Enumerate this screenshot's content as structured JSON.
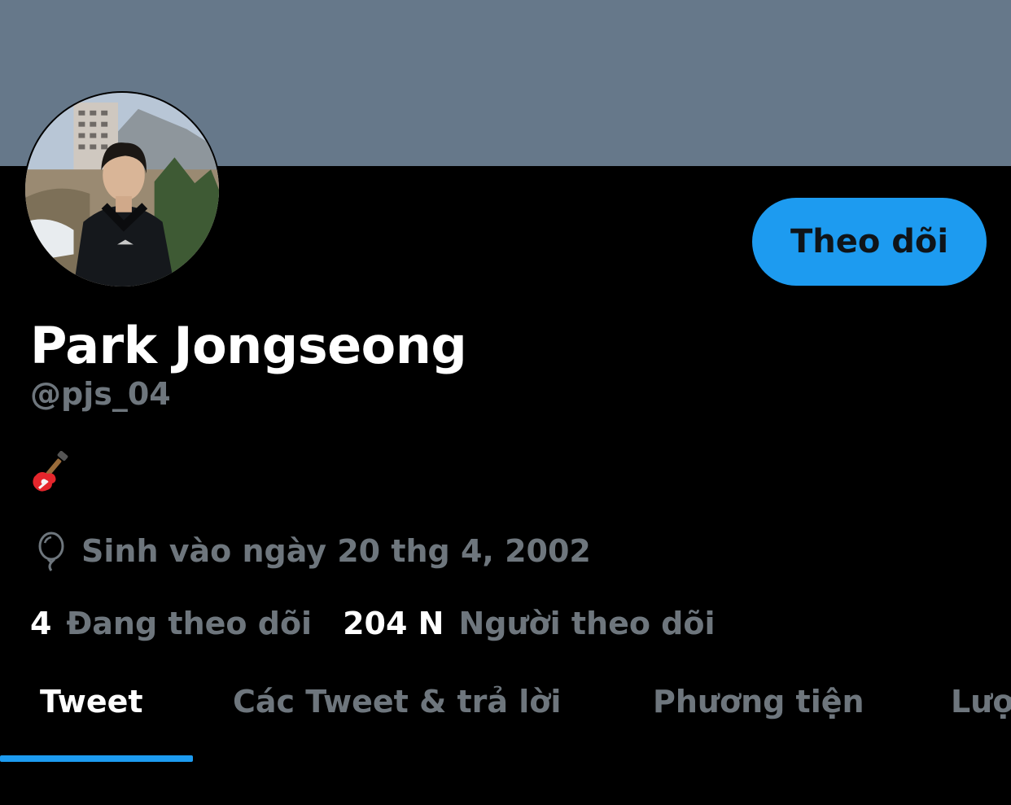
{
  "profile": {
    "name": "Park Jongseong",
    "handle": "@pjs_04",
    "bio_icon": "guitar-emoji",
    "birth_icon": "balloon-icon",
    "birthday": "Sinh vào ngày 20 thg 4, 2002"
  },
  "actions": {
    "follow_label": "Theo dõi"
  },
  "stats": {
    "following_count": "4",
    "following_label": "Đang theo dõi",
    "followers_count": "204 N",
    "followers_label": "Người theo dõi"
  },
  "tabs": [
    {
      "label": "Tweet",
      "active": true
    },
    {
      "label": "Các Tweet & trả lời",
      "active": false
    },
    {
      "label": "Phương tiện",
      "active": false
    },
    {
      "label": "Lượt thích",
      "active": false
    }
  ],
  "colors": {
    "banner": "#66788a",
    "accent": "#1d9bf0",
    "secondary_text": "#6e767d",
    "background": "#000000"
  }
}
